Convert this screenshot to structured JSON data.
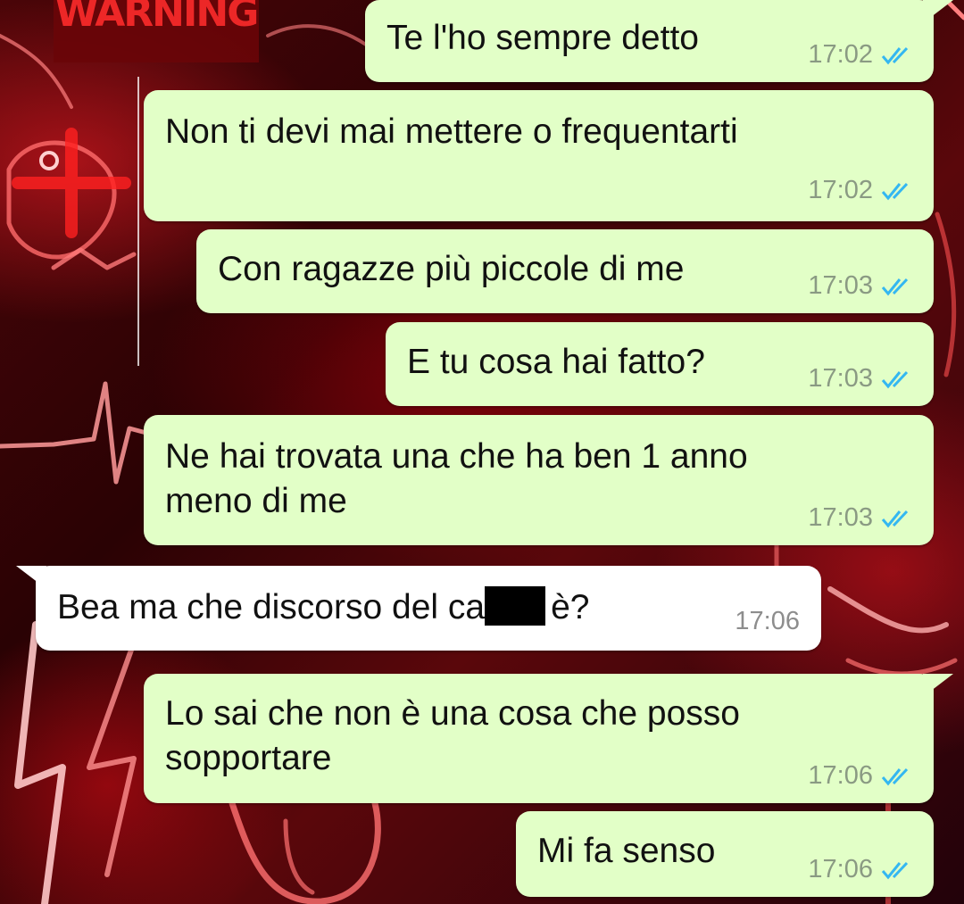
{
  "wallpaper": {
    "sign_text": "WARNING"
  },
  "colors": {
    "outgoing_bubble": "#e2ffc7",
    "incoming_bubble": "#ffffff",
    "read_ticks": "#34b7f1"
  },
  "messages": [
    {
      "direction": "outgoing",
      "text": "Te l'ho sempre detto",
      "time": "17:02",
      "status": "read"
    },
    {
      "direction": "outgoing",
      "text": "Non ti devi mai mettere o frequentarti",
      "time": "17:02",
      "status": "read"
    },
    {
      "direction": "outgoing",
      "text": "Con ragazze più piccole di me",
      "time": "17:03",
      "status": "read"
    },
    {
      "direction": "outgoing",
      "text": "E tu cosa hai fatto?",
      "time": "17:03",
      "status": "read"
    },
    {
      "direction": "outgoing",
      "text": "Ne hai trovata una che ha ben 1 anno\nmeno di me",
      "time": "17:03",
      "status": "read"
    },
    {
      "direction": "incoming",
      "text_before": "Bea ma che discorso del ca",
      "text_after": "è?",
      "redacted": true,
      "time": "17:06"
    },
    {
      "direction": "outgoing",
      "text": "Lo sai che non è una cosa che posso\nsopportare",
      "time": "17:06",
      "status": "read"
    },
    {
      "direction": "outgoing",
      "text": "Mi fa senso",
      "time": "17:06",
      "status": "read"
    }
  ]
}
